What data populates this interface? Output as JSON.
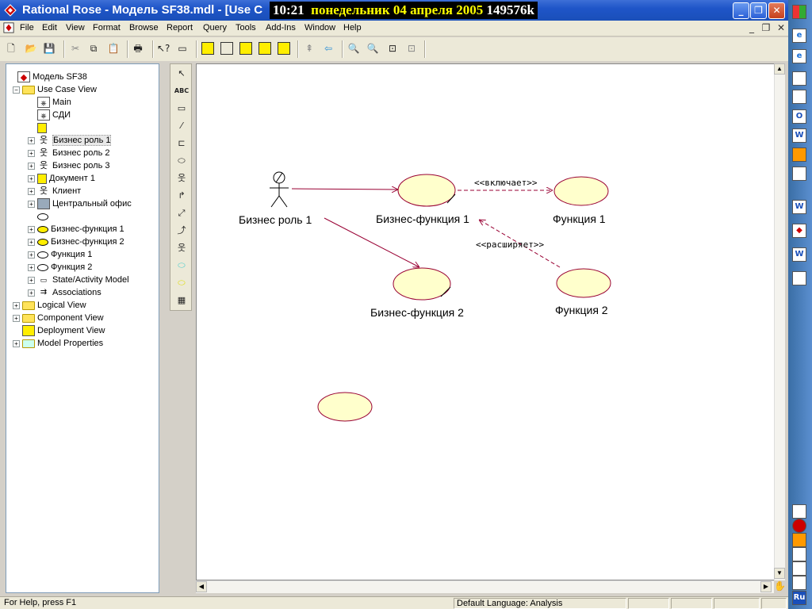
{
  "window": {
    "title": "Rational Rose - Модель SF38.mdl - [Use C",
    "overlay": {
      "time": "10:21",
      "date": "понедельник 04 апреля 2005",
      "mem": "149576k"
    },
    "buttons": {
      "minimize": "_",
      "maximize": "❐",
      "close": "✕"
    }
  },
  "menu": [
    "File",
    "Edit",
    "View",
    "Format",
    "Browse",
    "Report",
    "Query",
    "Tools",
    "Add-Ins",
    "Window",
    "Help"
  ],
  "toolbar_icons": [
    "new-icon",
    "open-icon",
    "save-icon",
    "cut-icon",
    "copy-icon",
    "paste-icon",
    "print-icon",
    "context-help-icon",
    "view-doc-icon",
    "browse-class-diagram-icon",
    "browse-interaction-diagram-icon",
    "browse-component-diagram-icon",
    "browse-deployment-diagram-icon",
    "browse-parent-icon",
    "browse-previous-icon",
    "zoom-in-icon",
    "zoom-out-icon",
    "fit-in-window-icon",
    "undo-fit-icon"
  ],
  "tree": [
    {
      "label": "Модель SF38",
      "level": 0,
      "icon": "model-icon",
      "exp": ""
    },
    {
      "label": "Use Case View",
      "level": 1,
      "icon": "folder",
      "exp": "−"
    },
    {
      "label": "Main",
      "level": 2,
      "icon": "diagram-icon",
      "exp": ""
    },
    {
      "label": "СДИ",
      "level": 2,
      "icon": "diagram-icon",
      "exp": ""
    },
    {
      "label": "",
      "level": 2,
      "icon": "doc",
      "exp": ""
    },
    {
      "label": "Бизнес роль 1",
      "level": 2,
      "icon": "actor",
      "exp": "+",
      "selected": true
    },
    {
      "label": "Бизнес роль 2",
      "level": 2,
      "icon": "actor",
      "exp": "+"
    },
    {
      "label": "Бизнес роль 3",
      "level": 2,
      "icon": "actor",
      "exp": "+"
    },
    {
      "label": "Документ 1",
      "level": 2,
      "icon": "doc",
      "exp": "+"
    },
    {
      "label": "Клиент",
      "level": 2,
      "icon": "actor",
      "exp": "+"
    },
    {
      "label": "Центральный офис",
      "level": 2,
      "icon": "building",
      "exp": "+"
    },
    {
      "label": "",
      "level": 2,
      "icon": "ellipse",
      "exp": ""
    },
    {
      "label": "Бизнес-функция 1",
      "level": 2,
      "icon": "ellipse-filled",
      "exp": "+"
    },
    {
      "label": "Бизнес-функция 2",
      "level": 2,
      "icon": "ellipse-filled",
      "exp": "+"
    },
    {
      "label": "Функция 1",
      "level": 2,
      "icon": "ellipse",
      "exp": "+"
    },
    {
      "label": "Функция 2",
      "level": 2,
      "icon": "ellipse",
      "exp": "+"
    },
    {
      "label": "State/Activity Model",
      "level": 2,
      "icon": "state",
      "exp": "+"
    },
    {
      "label": "Associations",
      "level": 2,
      "icon": "assoc",
      "exp": "+"
    },
    {
      "label": "Logical View",
      "level": 1,
      "icon": "folder",
      "exp": "+"
    },
    {
      "label": "Component View",
      "level": 1,
      "icon": "folder",
      "exp": "+"
    },
    {
      "label": "Deployment View",
      "level": 1,
      "icon": "deploy",
      "exp": ""
    },
    {
      "label": "Model Properties",
      "level": 1,
      "icon": "props",
      "exp": "+"
    }
  ],
  "palette_tools": [
    {
      "name": "selection-arrow-tool",
      "glyph": "↖"
    },
    {
      "name": "text-box-tool",
      "glyph": "ABC"
    },
    {
      "name": "note-tool",
      "glyph": "▭"
    },
    {
      "name": "anchor-note-tool",
      "glyph": "⁄"
    },
    {
      "name": "package-tool",
      "glyph": "⊏"
    },
    {
      "name": "use-case-tool",
      "glyph": "⬭"
    },
    {
      "name": "actor-tool",
      "glyph": "웃"
    },
    {
      "name": "unidirectional-association-tool",
      "glyph": "↱"
    },
    {
      "name": "dependency-tool",
      "glyph": "⤢"
    },
    {
      "name": "generalization-tool",
      "glyph": "⤴"
    },
    {
      "name": "business-actor-tool",
      "glyph": "웃"
    },
    {
      "name": "business-use-case-tool",
      "glyph": "⬭"
    },
    {
      "name": "business-use-case-realization-tool",
      "glyph": "⬭"
    },
    {
      "name": "business-worker-tool",
      "glyph": "▦"
    }
  ],
  "diagram": {
    "actor_label": "Бизнес роль 1",
    "use_cases": [
      "Бизнес-функция 1",
      "Функция 1",
      "Бизнес-функция 2",
      "Функция 2",
      ""
    ],
    "stereotypes": {
      "includes": "<<включает>>",
      "extends": "<<расширяет>>"
    },
    "colors": {
      "usecase_fill": "#ffffcc",
      "usecase_stroke": "#990033",
      "line": "#990033"
    }
  },
  "status": {
    "help": "For Help, press F1",
    "language": "Default Language: Analysis"
  },
  "sidebar_icons": [
    "windows-logo-icon",
    "ie-icon",
    "ie-icon",
    "printer-icon",
    "excel-icon",
    "outlook-icon",
    "word-icon",
    "clock-icon",
    "notepad-icon",
    "word-doc-icon",
    "rose-icon",
    "word-doc-icon",
    "arrow-up-icon",
    "floppy-icon",
    "record-icon",
    "clock-icon",
    "pen-icon",
    "spell-icon",
    "language-icon"
  ],
  "language_badge": "Ru"
}
